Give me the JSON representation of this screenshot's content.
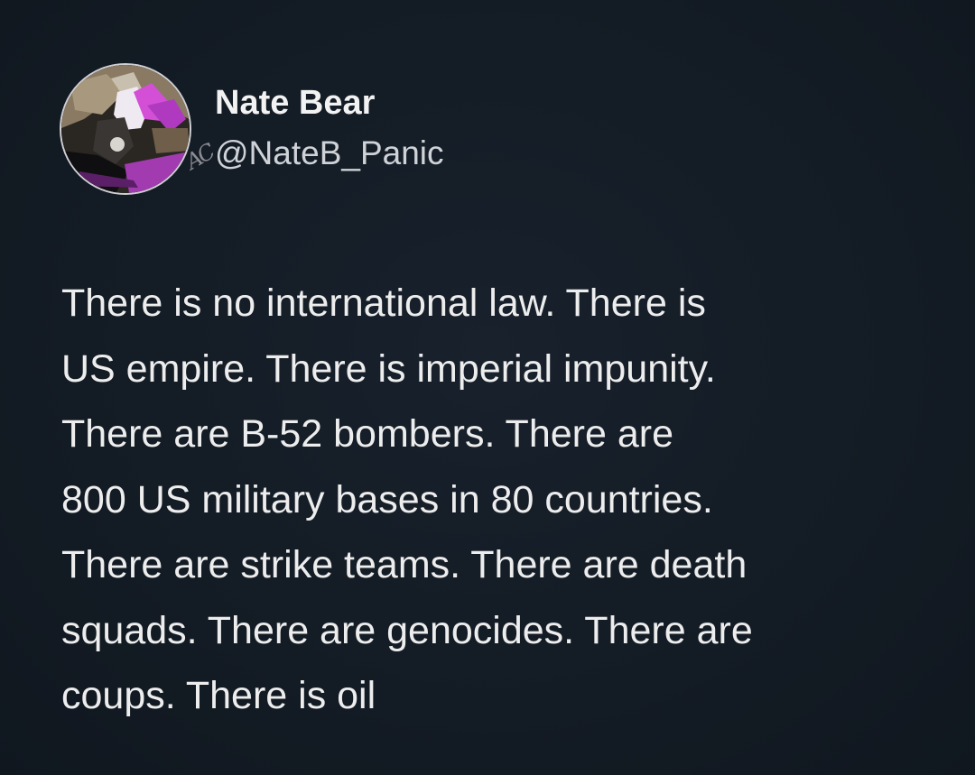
{
  "tweet": {
    "author": {
      "display_name": "Nate Bear",
      "handle_mark": "AC",
      "handle": "@NateB_Panic",
      "avatar_icon": "profile-photo-avatar"
    },
    "text_lines": [
      "There is no international law. There is",
      "US empire. There is imperial impunity.",
      "There are B-52 bombers. There are",
      "800 US military bases in 80 countries.",
      "There are strike teams. There are death",
      "squads. There are genocides. There are",
      "coups. There is oil"
    ]
  },
  "colors": {
    "background": "#141c26",
    "text": "#ededed",
    "handle": "#cfd3d8"
  }
}
